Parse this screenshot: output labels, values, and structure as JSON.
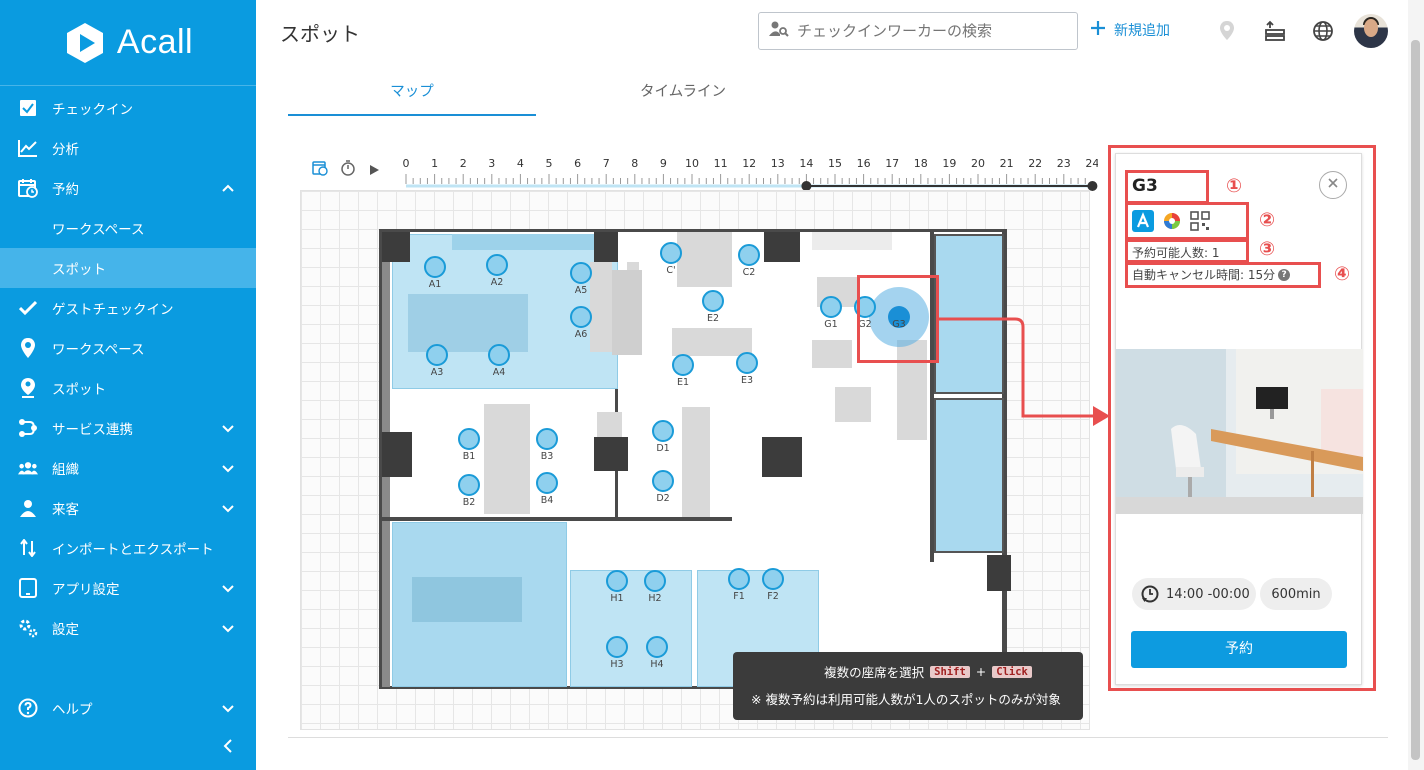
{
  "brand": {
    "name": "Acall"
  },
  "sidebar": {
    "items": [
      {
        "label": "チェックイン",
        "icon": "checkbox-icon"
      },
      {
        "label": "分析",
        "icon": "chart-icon"
      },
      {
        "label": "予約",
        "icon": "calendar-icon"
      },
      {
        "label": "ゲストチェックイン",
        "icon": "check-icon"
      },
      {
        "label": "ワークスペース",
        "icon": "pin-icon"
      },
      {
        "label": "スポット",
        "icon": "person-pin-icon"
      },
      {
        "label": "サービス連携",
        "icon": "integration-icon"
      },
      {
        "label": "組織",
        "icon": "group-icon"
      },
      {
        "label": "来客",
        "icon": "visitor-icon"
      },
      {
        "label": "インポートとエクスポート",
        "icon": "import-export-icon"
      },
      {
        "label": "アプリ設定",
        "icon": "tablet-icon"
      },
      {
        "label": "設定",
        "icon": "settings-icon"
      },
      {
        "label": "ヘルプ",
        "icon": "help-icon"
      }
    ],
    "sub_items": [
      {
        "label": "ワークスペース"
      },
      {
        "label": "スポット"
      }
    ]
  },
  "header": {
    "title": "スポット",
    "search_placeholder": "チェックインワーカーの検索",
    "add_label": "新規追加"
  },
  "tabs": [
    {
      "label": "マップ",
      "active": true
    },
    {
      "label": "タイムライン",
      "active": false
    }
  ],
  "ruler": {
    "hours": [
      "0",
      "1",
      "2",
      "3",
      "4",
      "5",
      "6",
      "7",
      "8",
      "9",
      "10",
      "11",
      "12",
      "13",
      "14",
      "15",
      "16",
      "17",
      "18",
      "19",
      "20",
      "21",
      "22",
      "23",
      "24"
    ],
    "range_start": 14,
    "range_end": 24
  },
  "seats": [
    {
      "id": "A1"
    },
    {
      "id": "A2"
    },
    {
      "id": "A3"
    },
    {
      "id": "A4"
    },
    {
      "id": "A5"
    },
    {
      "id": "A6"
    },
    {
      "id": "B1"
    },
    {
      "id": "B2"
    },
    {
      "id": "B3"
    },
    {
      "id": "B4"
    },
    {
      "id": "C'"
    },
    {
      "id": "C2"
    },
    {
      "id": "D1"
    },
    {
      "id": "D2"
    },
    {
      "id": "E1"
    },
    {
      "id": "E2"
    },
    {
      "id": "E3"
    },
    {
      "id": "F1"
    },
    {
      "id": "F2"
    },
    {
      "id": "G1"
    },
    {
      "id": "G2"
    },
    {
      "id": "G3"
    },
    {
      "id": "H1"
    },
    {
      "id": "H2"
    },
    {
      "id": "H3"
    },
    {
      "id": "H4"
    }
  ],
  "tooltip": {
    "multi_select": "複数の座席を選択",
    "key1": "Shift",
    "plus": "+",
    "key2": "Click",
    "note": "※ 複数予約は利用可能人数が1人のスポットのみが対象"
  },
  "panel": {
    "name": "G3",
    "capacity": "予約可能人数: 1",
    "auto_cancel": "自動キャンセル時間: 15分",
    "time_range": "14:00 -00:00",
    "duration": "600min",
    "book_label": "予約"
  },
  "annotations": [
    "①",
    "②",
    "③",
    "④"
  ],
  "colors": {
    "sidebar": "#0a9be0",
    "accent": "#1a8fd6",
    "annotation": "#e84f4f",
    "seat": "#8fd0ee"
  }
}
